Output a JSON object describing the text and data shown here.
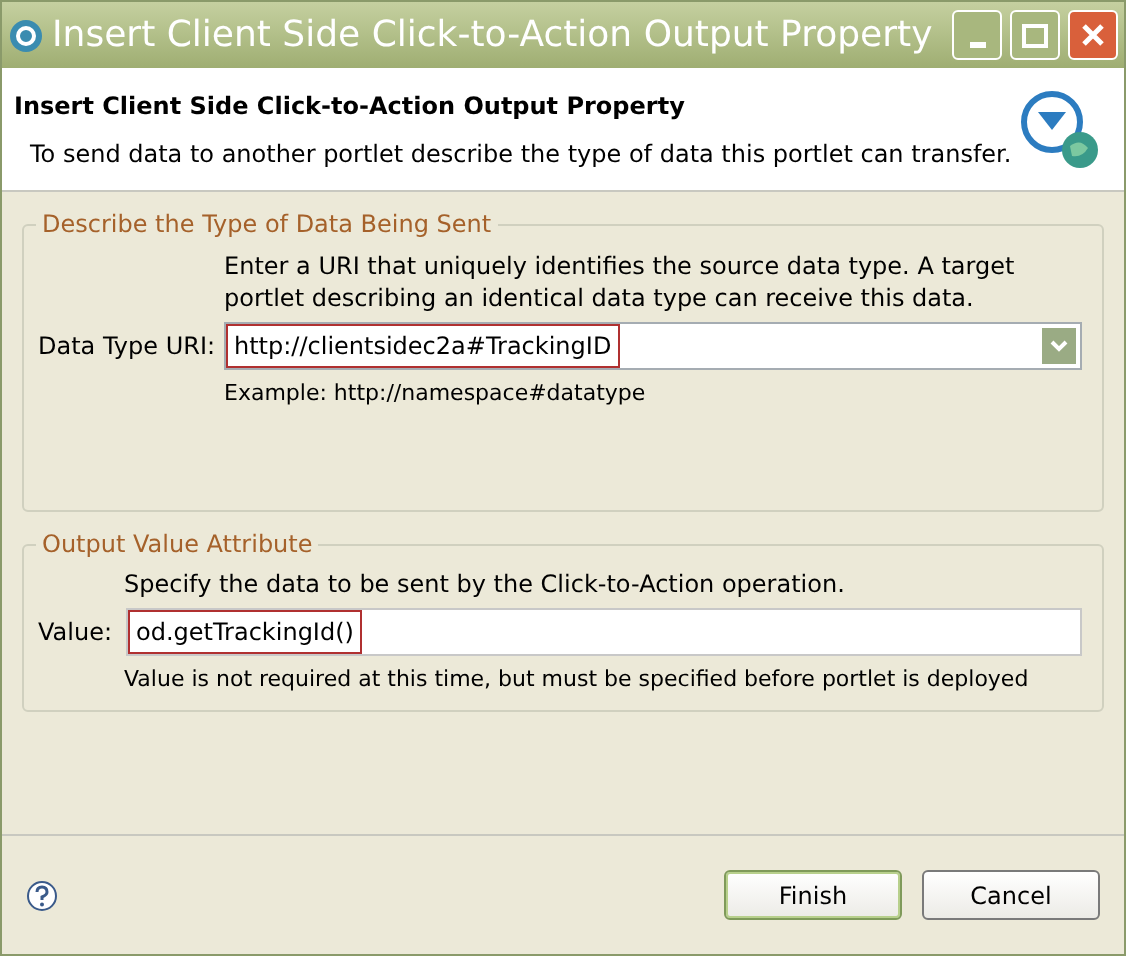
{
  "window": {
    "title": "Insert Client Side Click-to-Action Output Property"
  },
  "header": {
    "title": "Insert Client Side Click-to-Action Output Property",
    "description": "To send data to another portlet describe the type of data this portlet can transfer."
  },
  "groups": [
    {
      "title": "Describe the Type of Data Being Sent",
      "kind": "combo",
      "instructions": "Enter a URI that uniquely identifies the source data type. A target portlet describing an identical data type can receive this data.",
      "label": "Data Type URI:",
      "value": "http://clientsidec2a#TrackingID",
      "hint": "Example: http://namespace#datatype",
      "highlighted": true
    },
    {
      "title": "Output Value Attribute",
      "kind": "text",
      "instructions": "Specify the data to be sent by the Click-to-Action operation.",
      "label": "Value:",
      "value": "od.getTrackingId()",
      "hint": "Value is not required at this time, but must be specified before portlet is deployed",
      "highlighted": true
    }
  ],
  "buttons": [
    {
      "label": "Finish",
      "default": true
    },
    {
      "label": "Cancel",
      "default": false
    }
  ]
}
